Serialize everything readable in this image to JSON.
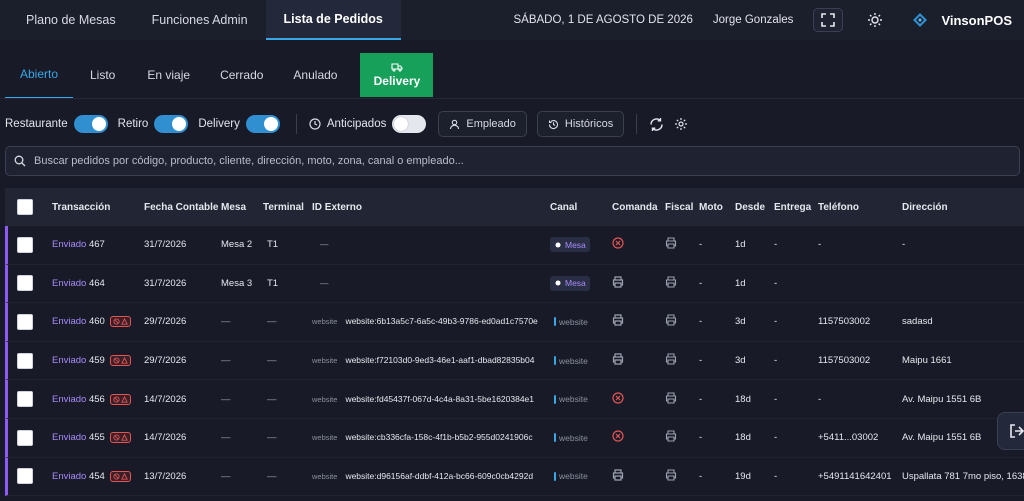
{
  "topbar": {
    "tabs": [
      {
        "label": "Plano de Mesas"
      },
      {
        "label": "Funciones Admin"
      },
      {
        "label": "Lista de Pedidos"
      }
    ],
    "date": "SÁBADO, 1 DE AGOSTO DE 2026",
    "user": "Jorge Gonzales",
    "brand": "VinsonPOS"
  },
  "status_tabs": [
    {
      "label": "Abierto"
    },
    {
      "label": "Listo"
    },
    {
      "label": "En viaje"
    },
    {
      "label": "Cerrado"
    },
    {
      "label": "Anulado"
    },
    {
      "label": "Delivery"
    }
  ],
  "filters": {
    "restaurante": "Restaurante",
    "retiro": "Retiro",
    "delivery": "Delivery",
    "anticipados": "Anticipados",
    "empleado": "Empleado",
    "historicos": "Históricos"
  },
  "search": {
    "placeholder": "Buscar pedidos por código, producto, cliente, dirección, moto, zona, canal o empleado..."
  },
  "table": {
    "headers": {
      "transaccion": "Transacción",
      "fecha": "Fecha Contable",
      "mesa": "Mesa",
      "terminal": "Terminal",
      "id_externo": "ID Externo",
      "canal": "Canal",
      "comanda": "Comanda",
      "fiscal": "Fiscal",
      "moto": "Moto",
      "desde": "Desde",
      "entrega": "Entrega",
      "telefono": "Teléfono",
      "direccion": "Dirección"
    },
    "rows": [
      {
        "estado": "Enviado",
        "num": "467",
        "fecha": "31/7/2026",
        "mesa": "Mesa 2",
        "terminal": "T1",
        "id_tag": "",
        "id": "—",
        "canal": "Mesa",
        "moto": "-",
        "desde": "1d",
        "entrega": "-",
        "telefono": "-",
        "direccion": "-"
      },
      {
        "estado": "Enviado",
        "num": "464",
        "fecha": "31/7/2026",
        "mesa": "Mesa 3",
        "terminal": "T1",
        "id_tag": "",
        "id": "—",
        "canal": "Mesa",
        "moto": "-",
        "desde": "1d",
        "entrega": "-",
        "telefono": "",
        "direccion": ""
      },
      {
        "estado": "Enviado",
        "num": "460",
        "fecha": "29/7/2026",
        "mesa": "—",
        "terminal": "—",
        "id_tag": "website",
        "id": "website:6b13a5c7-6a5c-49b3-9786-ed0ad1c7570e",
        "canal": "website",
        "moto": "-",
        "desde": "3d",
        "entrega": "-",
        "telefono": "1157503002",
        "direccion": "sadasd"
      },
      {
        "estado": "Enviado",
        "num": "459",
        "fecha": "29/7/2026",
        "mesa": "—",
        "terminal": "—",
        "id_tag": "website",
        "id": "website:f72103d0-9ed3-46e1-aaf1-dbad82835b04",
        "canal": "website",
        "moto": "-",
        "desde": "3d",
        "entrega": "-",
        "telefono": "1157503002",
        "direccion": "Maipu 1661"
      },
      {
        "estado": "Enviado",
        "num": "456",
        "fecha": "14/7/2026",
        "mesa": "—",
        "terminal": "—",
        "id_tag": "website",
        "id": "website:fd45437f-067d-4c4a-8a31-5be1620384e1",
        "canal": "website",
        "moto": "-",
        "desde": "18d",
        "entrega": "-",
        "telefono": "-",
        "direccion": "Av. Maipu 1551 6B"
      },
      {
        "estado": "Enviado",
        "num": "455",
        "fecha": "14/7/2026",
        "mesa": "—",
        "terminal": "—",
        "id_tag": "website",
        "id": "website:cb336cfa-158c-4f1b-b5b2-955d0241906c",
        "canal": "website",
        "moto": "-",
        "desde": "18d",
        "entrega": "-",
        "telefono": "+5411...03002",
        "direccion": "Av. Maipu 1551 6B"
      },
      {
        "estado": "Enviado",
        "num": "454",
        "fecha": "13/7/2026",
        "mesa": "—",
        "terminal": "—",
        "id_tag": "website",
        "id": "website:d96156af-ddbf-412a-bc66-609c0cb4292d",
        "canal": "website",
        "moto": "-",
        "desde": "19d",
        "entrega": "-",
        "telefono": "+5491141642401",
        "direccion": "Uspallata 781 7mo piso, 1638"
      }
    ]
  }
}
